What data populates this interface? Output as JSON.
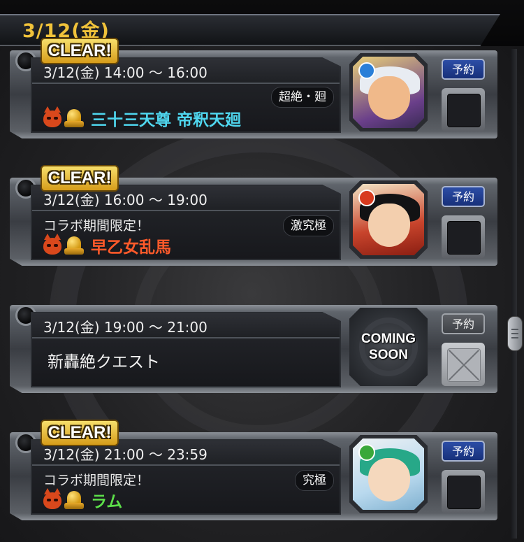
{
  "header": {
    "date": "3/12(金)"
  },
  "common": {
    "clear_label": "CLEAR!"
  },
  "quests": [
    {
      "time": "3/12(金) 14:00 ～ 16:00",
      "collab": "",
      "rank": "超絶・廻",
      "name": "三十三天尊 帝釈天廻",
      "name_color": "#4fd6ee",
      "reserve": "予約",
      "cleared": true
    },
    {
      "time": "3/12(金) 16:00 ～ 19:00",
      "collab": "コラボ期間限定！",
      "rank": "激究極",
      "name": "早乙女乱馬",
      "name_color": "#ff5a2a",
      "reserve": "予約",
      "cleared": true
    },
    {
      "time": "3/12(金) 19:00 ～ 21:00",
      "name": "新轟絶クエスト",
      "name_color": "#f2f2f2",
      "coming_1": "COMING",
      "coming_2": "SOON",
      "reserve": "予約",
      "cleared": false
    },
    {
      "time": "3/12(金) 21:00 ～ 23:59",
      "collab": "コラボ期間限定！",
      "rank": "究極",
      "name": "ラム",
      "name_color": "#5de04a",
      "reserve": "予約",
      "cleared": true
    }
  ]
}
